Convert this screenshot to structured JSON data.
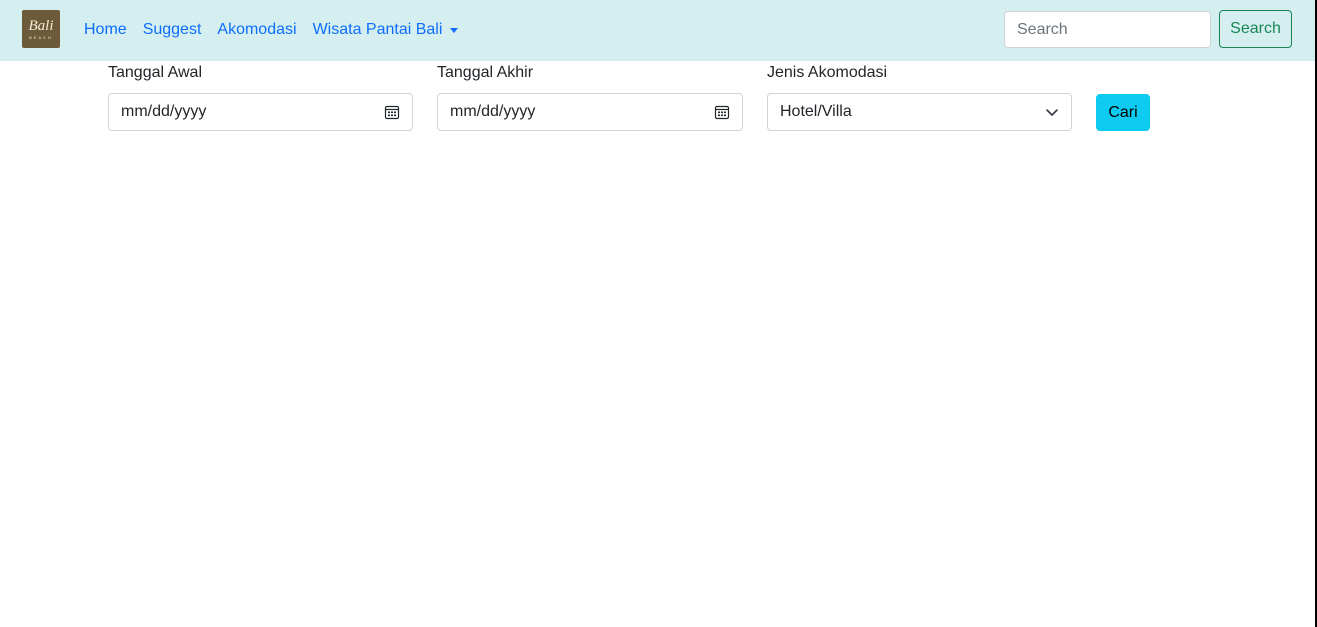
{
  "navbar": {
    "brand": {
      "logo_text": "Bali",
      "logo_subtext": "BEACH"
    },
    "links": [
      {
        "label": "Home"
      },
      {
        "label": "Suggest"
      },
      {
        "label": "Akomodasi"
      },
      {
        "label": "Wisata Pantai Bali",
        "has_dropdown": true
      }
    ],
    "search": {
      "placeholder": "Search",
      "button_label": "Search"
    }
  },
  "form": {
    "start_date": {
      "label": "Tanggal Awal",
      "value": "mm/dd/yyyy",
      "icon": "calendar-icon"
    },
    "end_date": {
      "label": "Tanggal Akhir",
      "value": "mm/dd/yyyy",
      "icon": "calendar-icon"
    },
    "accommodation_type": {
      "label": "Jenis Akomodasi",
      "selected": "Hotel/Villa",
      "icon": "chevron-down-icon"
    },
    "submit_label": "Cari"
  },
  "colors": {
    "navbar_bg": "#d5eff0",
    "link": "#0d6efd",
    "search_button": "#198754",
    "cari_button": "#0dcaf0"
  }
}
